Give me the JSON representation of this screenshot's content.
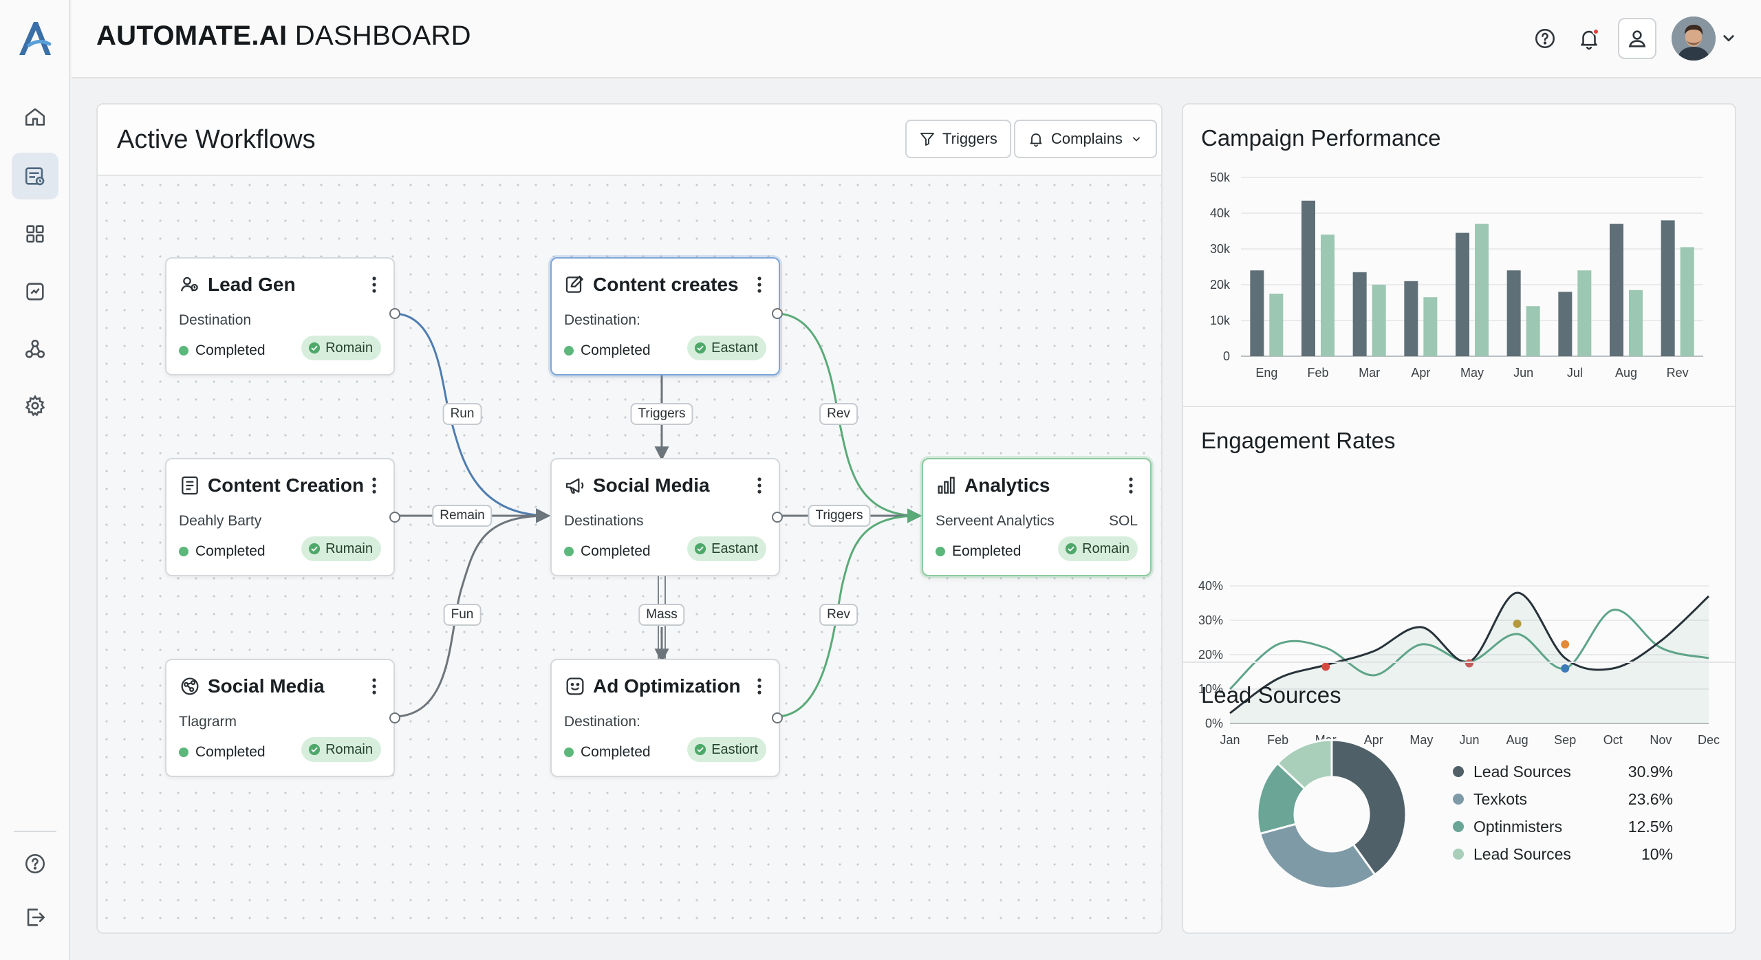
{
  "app": {
    "title_bold": "AUTOMATE.AI",
    "title_rest": " DASHBOARD"
  },
  "sidebar": {
    "items": [
      {
        "icon": "home-icon",
        "active": false
      },
      {
        "icon": "workflow-icon",
        "active": true
      },
      {
        "icon": "grid-icon",
        "active": false
      },
      {
        "icon": "media-icon",
        "active": false
      },
      {
        "icon": "integrations-icon",
        "active": false
      },
      {
        "icon": "gear-icon",
        "active": false
      }
    ],
    "bottom": [
      {
        "icon": "help-icon"
      },
      {
        "icon": "logout-icon"
      }
    ]
  },
  "header": {
    "icons": [
      "help-icon",
      "bell-icon",
      "user-icon"
    ],
    "notification_color": "#e0413a"
  },
  "workflows": {
    "title": "Active Workflows",
    "filters": [
      {
        "label": "Triggers",
        "icon": "filter-icon"
      },
      {
        "label": "Complains",
        "icon": "bell-icon",
        "dropdown": true
      }
    ],
    "nodes": [
      {
        "id": "lead-gen",
        "title": "Lead Gen",
        "icon": "lead-icon",
        "sub": "Destination",
        "extra": "",
        "status": "Completed",
        "pill": "Romain",
        "highlight": "none"
      },
      {
        "id": "content-creates",
        "title": "Content creates",
        "icon": "edit-icon",
        "sub": "Destination:",
        "extra": "",
        "status": "Completed",
        "pill": "Eastant",
        "highlight": "blue"
      },
      {
        "id": "content-creation",
        "title": "Content Creation",
        "icon": "document-icon",
        "sub": "Deahly Barty",
        "extra": "",
        "status": "Completed",
        "pill": "Rumain",
        "highlight": "none"
      },
      {
        "id": "social-media-center",
        "title": "Social Media",
        "icon": "megaphone-icon",
        "sub": "Destinations",
        "extra": "",
        "status": "Completed",
        "pill": "Eastant",
        "highlight": "none"
      },
      {
        "id": "analytics",
        "title": "Analytics",
        "icon": "bar-chart-icon",
        "sub": "Serveent Analytics",
        "extra": "SOL",
        "status": "Eompleted",
        "pill": "Romain",
        "highlight": "green"
      },
      {
        "id": "social-media-left",
        "title": "Social Media",
        "icon": "share-icon",
        "sub": "Tlagrarm",
        "extra": "",
        "status": "Completed",
        "pill": "Romain",
        "highlight": "none"
      },
      {
        "id": "ad-optimization",
        "title": "Ad Optimization",
        "icon": "smile-icon",
        "sub": "Destination:",
        "extra": "",
        "status": "Completed",
        "pill": "Eastiort",
        "highlight": "none"
      }
    ],
    "edge_labels": [
      "Run",
      "Triggers",
      "Rev",
      "Remain",
      "Triggers",
      "Fun",
      "Mass",
      "Rev"
    ],
    "colors": {
      "blue_link": "#4f7db0",
      "green_link": "#5aaa78",
      "gray_link": "#6d757c",
      "status_green": "#5cb77a",
      "pill_bg": "#d8eedd"
    }
  },
  "right": {
    "campaign_title": "Campaign Performance",
    "engagement_title": "Engagement Rates",
    "lead_title": "Lead Sources"
  },
  "chart_data": [
    {
      "type": "bar",
      "title": "Campaign Performance",
      "categories": [
        "Eng",
        "Feb",
        "Mar",
        "Apr",
        "May",
        "Jun",
        "Jul",
        "Aug",
        "Rev"
      ],
      "series": [
        {
          "values": [
            24000,
            43500,
            23500,
            21000,
            34500,
            24000,
            18000,
            37000,
            38000
          ],
          "color": "#5f6f78"
        },
        {
          "values": [
            17500,
            34000,
            20000,
            16500,
            37000,
            14000,
            24000,
            18500,
            30500
          ],
          "color": "#9cc7b2"
        }
      ],
      "ylim": [
        0,
        50000
      ],
      "yticks": [
        "0",
        "10k",
        "20k",
        "30k",
        "40k",
        "50k"
      ],
      "grid": true
    },
    {
      "type": "line",
      "title": "Engagement Rates",
      "categories": [
        "Jan",
        "Feb",
        "Mar",
        "Apr",
        "May",
        "Jun",
        "Aug",
        "Sep",
        "Oct",
        "Nov",
        "Dec"
      ],
      "series": [
        {
          "values": [
            3,
            13,
            17,
            21,
            28,
            18,
            38,
            19,
            16,
            24,
            37
          ],
          "color": "#27323a"
        },
        {
          "values": [
            10,
            23,
            22,
            14,
            23,
            18,
            26,
            16,
            33,
            22,
            19
          ],
          "color": "#5ea489"
        }
      ],
      "markers": [
        {
          "x": "Mar",
          "y": 16.5,
          "color": "#d64a3f"
        },
        {
          "x": "Jun",
          "y": 17.5,
          "color": "#c45a5a"
        },
        {
          "x": "Aug",
          "y": 29,
          "color": "#b49a3a"
        },
        {
          "x": "Sep",
          "y": 23,
          "color": "#e38a3a"
        },
        {
          "x": "Sep",
          "y": 16,
          "color": "#3a7ab8"
        }
      ],
      "ylim": [
        0,
        40
      ],
      "yticks": [
        "0%",
        "10%",
        "20%",
        "30%",
        "40%"
      ],
      "grid": true
    },
    {
      "type": "pie",
      "title": "Lead Sources",
      "labels": [
        "Lead Sources",
        "Texkots",
        "Optinmisters",
        "Lead Sources"
      ],
      "values": [
        30.9,
        23.6,
        12.5,
        10
      ],
      "display": [
        "30.9%",
        "23.6%",
        "12.5%",
        "10%"
      ],
      "colors": [
        "#4f6068",
        "#7d9aa6",
        "#6aa596",
        "#a9cfba"
      ]
    }
  ]
}
